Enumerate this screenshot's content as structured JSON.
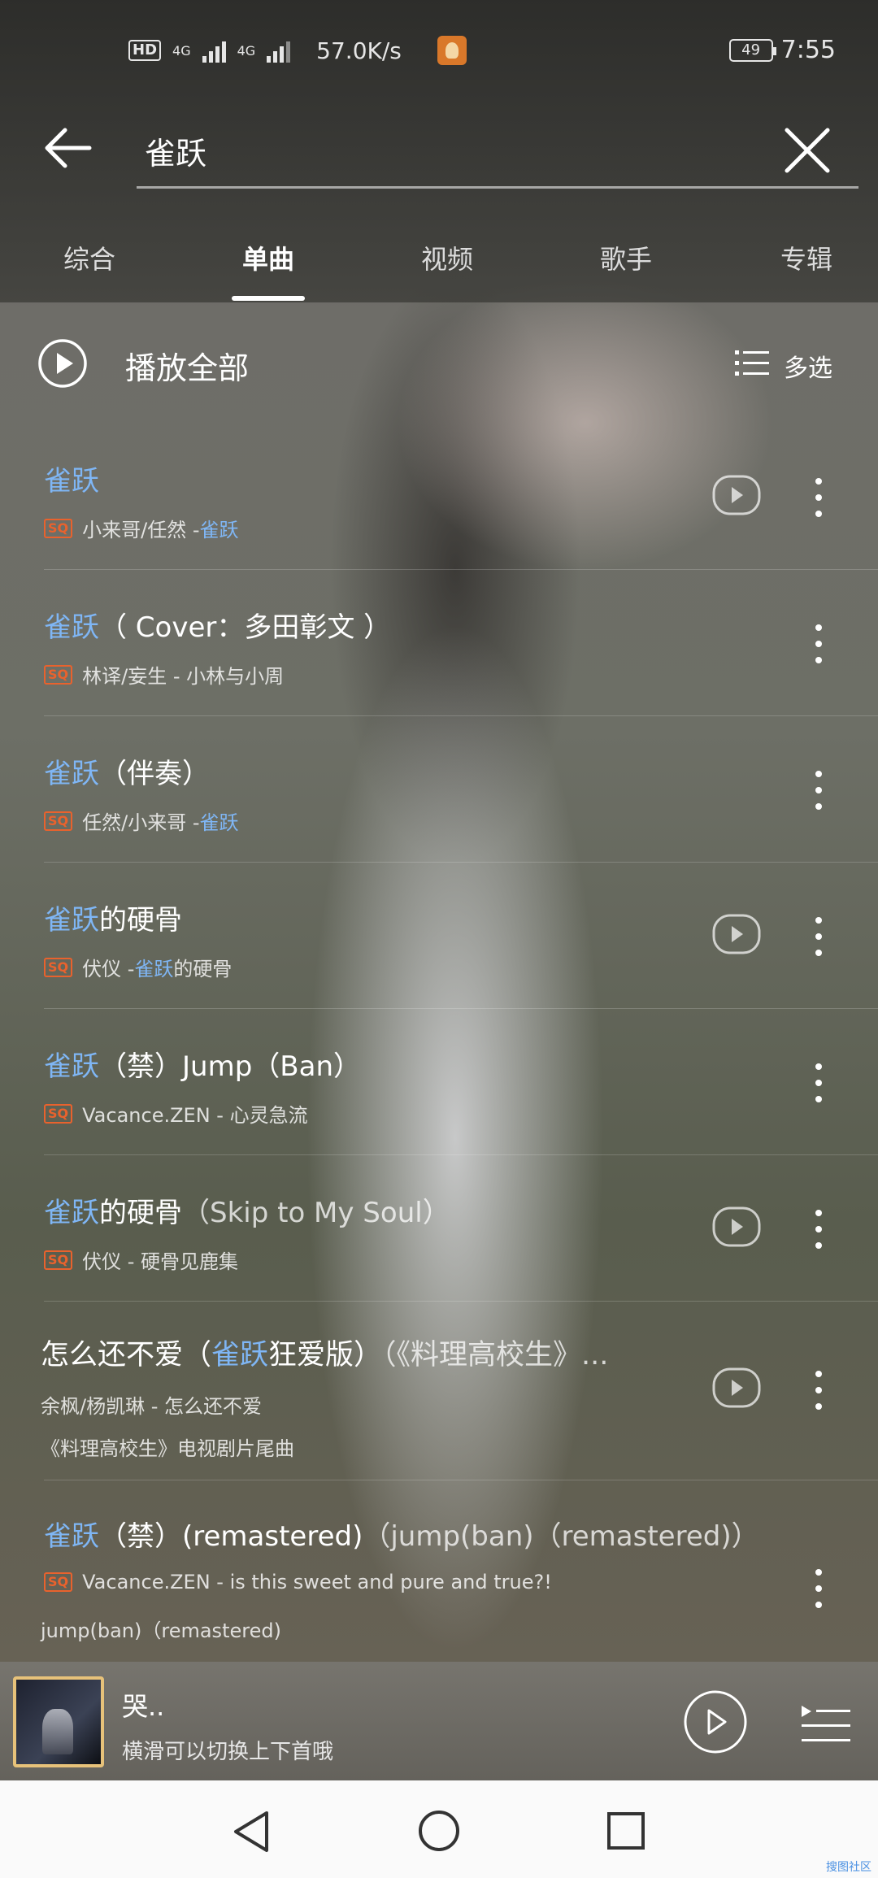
{
  "status_bar": {
    "hd": "HD",
    "network_1": "4G",
    "network_2": "4G",
    "speed": "57.0K/s",
    "battery": "49",
    "time": "7:55"
  },
  "search": {
    "query": "雀跃"
  },
  "tabs": [
    {
      "label": "综合"
    },
    {
      "label": "单曲"
    },
    {
      "label": "视频"
    },
    {
      "label": "歌手"
    },
    {
      "label": "专辑"
    }
  ],
  "active_tab": "单曲",
  "play_all": {
    "label": "播放全部",
    "multi_select": "多选"
  },
  "songs": [
    {
      "title_hl": "雀跃",
      "title_rest": "",
      "title_dim": "",
      "badge": "SQ",
      "sub_pre": "小来哥/任然 - ",
      "sub_hl": "雀跃",
      "sub_post": "",
      "has_mv": true
    },
    {
      "title_hl": "雀跃",
      "title_rest": "（ Cover：多田彰文 ）",
      "title_dim": "",
      "badge": "SQ",
      "sub_pre": "林译/妄生 - 小林与小周",
      "sub_hl": "",
      "sub_post": "",
      "has_mv": false
    },
    {
      "title_hl": "雀跃",
      "title_rest": "（伴奏）",
      "title_dim": "",
      "badge": "SQ",
      "sub_pre": "任然/小来哥 - ",
      "sub_hl": "雀跃",
      "sub_post": "",
      "has_mv": false
    },
    {
      "title_hl": "雀跃",
      "title_rest": "的硬骨",
      "title_dim": "",
      "badge": "SQ",
      "sub_pre": "伏仪 - ",
      "sub_hl": "雀跃",
      "sub_post": "的硬骨",
      "has_mv": true
    },
    {
      "title_hl": "雀跃",
      "title_rest": "（禁）Jump（Ban）",
      "title_dim": "",
      "badge": "SQ",
      "sub_pre": "Vacance.ZEN - 心灵急流",
      "sub_hl": "",
      "sub_post": "",
      "has_mv": false
    },
    {
      "title_hl": "雀跃",
      "title_rest": "的硬骨",
      "title_dim": "（Skip to My Soul）",
      "badge": "SQ",
      "sub_pre": "伏仪 - 硬骨见鹿集",
      "sub_hl": "",
      "sub_post": "",
      "has_mv": true
    },
    {
      "title_pre": "怎么还不爱（",
      "title_hl": "雀跃",
      "title_rest": "狂爱版）",
      "title_dim": "（《料理高校生》...",
      "badge": "",
      "sub_pre": "余枫/杨凯琳 - 怎么还不爱",
      "sub_hl": "",
      "sub_post": "",
      "sub2": "《料理高校生》电视剧片尾曲",
      "has_mv": true
    },
    {
      "title_hl": "雀跃",
      "title_rest": "（禁）(remastered)",
      "title_dim": "（jump(ban)（remastered)）",
      "badge": "SQ",
      "sub_pre": "Vacance.ZEN - is this sweet and pure and true?!",
      "sub_hl": "",
      "sub_post": "",
      "sub2": "jump(ban)（remastered)",
      "has_mv": false
    }
  ],
  "now_playing": {
    "title": "哭..",
    "hint": "横滑可以切换上下首哦"
  },
  "watermark": "搜图社区"
}
